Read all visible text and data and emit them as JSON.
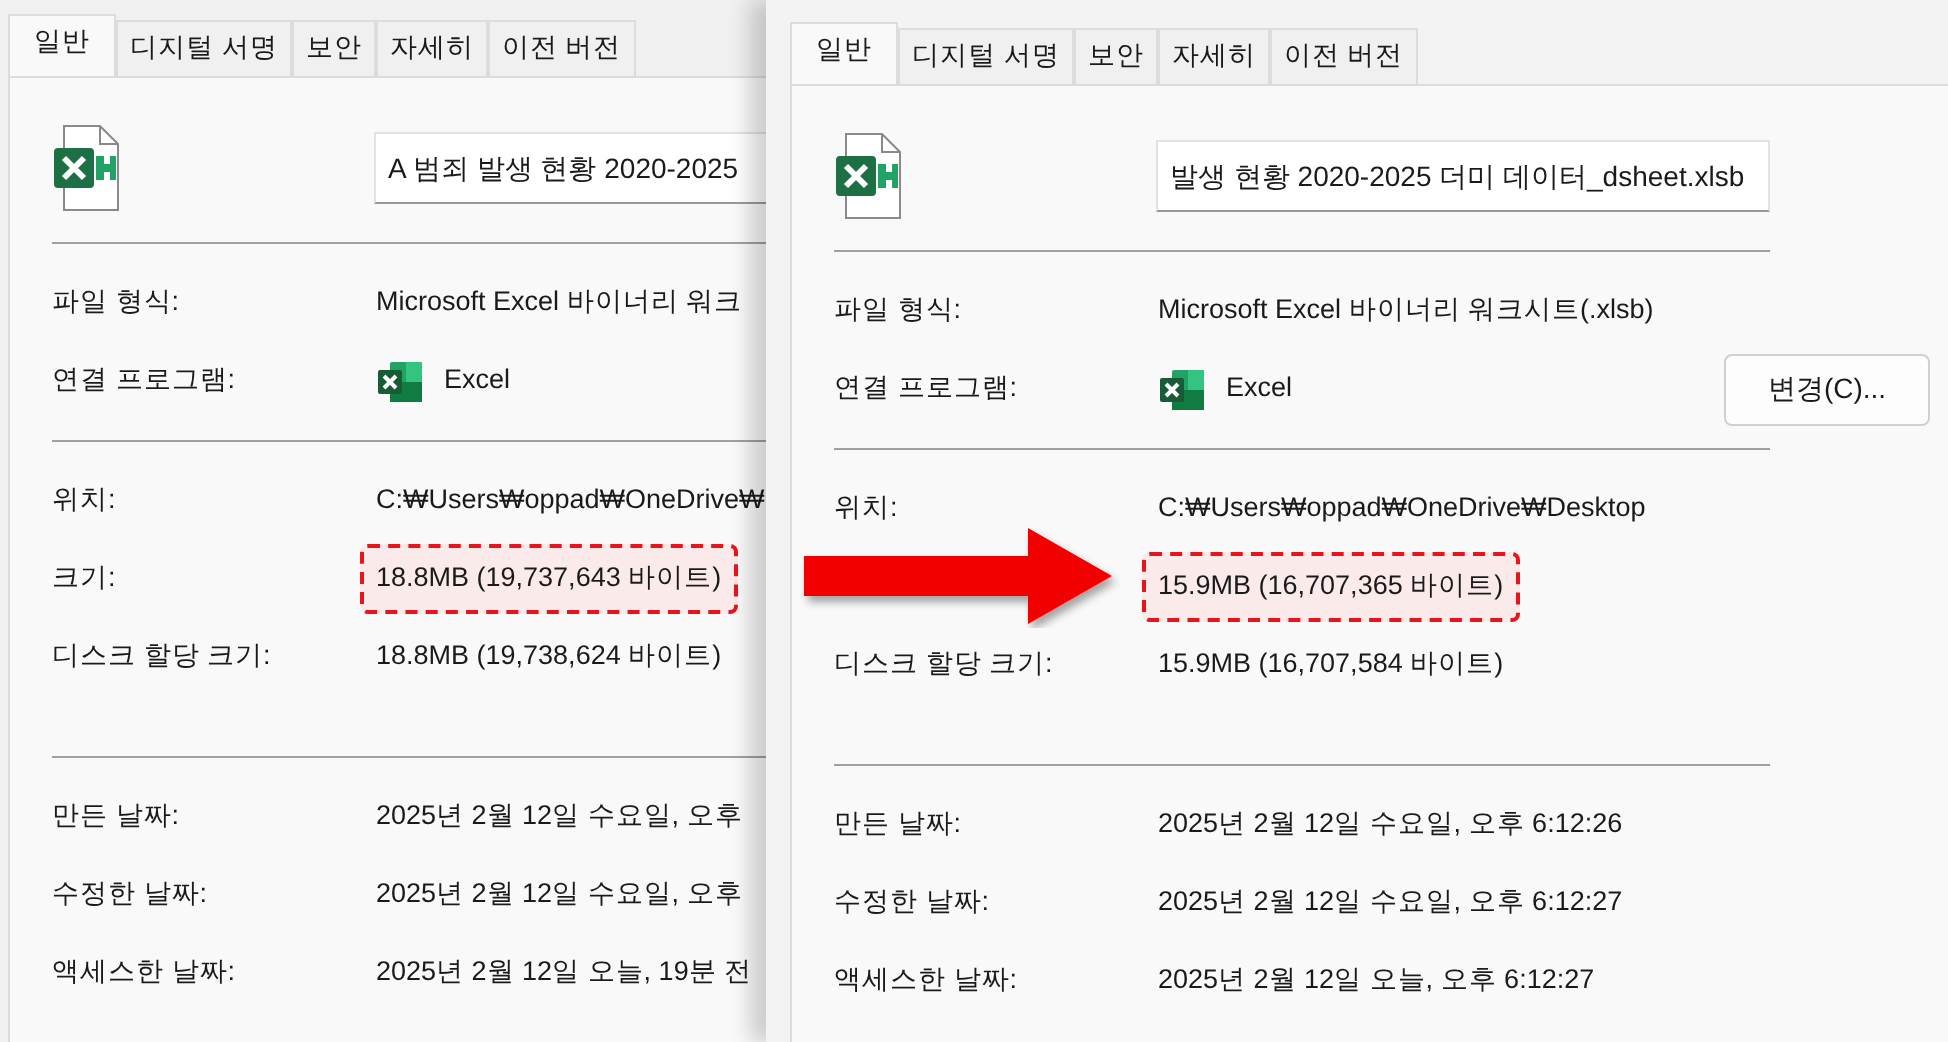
{
  "dialogs": [
    {
      "tabs": [
        {
          "label": "일반",
          "selected": true
        },
        {
          "label": "디지털 서명",
          "selected": false
        },
        {
          "label": "보안",
          "selected": false
        },
        {
          "label": "자세히",
          "selected": false
        },
        {
          "label": "이전 버전",
          "selected": false
        }
      ],
      "file_name": "A 범죄 발생 현황 2020-2025",
      "sections": [
        [
          {
            "kind": "text",
            "label": "파일 형식:",
            "value": "Microsoft Excel 바이너리 워크",
            "highlighted": false
          },
          {
            "kind": "program",
            "label": "연결 프로그램:",
            "value": "Excel",
            "highlighted": false
          }
        ],
        [
          {
            "kind": "text",
            "label": "위치:",
            "value": "C:₩Users₩oppad₩OneDrive₩",
            "highlighted": false
          },
          {
            "kind": "text",
            "label": "크기:",
            "value": "18.8MB (19,737,643 바이트)",
            "highlighted": true
          },
          {
            "kind": "text",
            "label": "디스크 할당 크기:",
            "value": "18.8MB (19,738,624 바이트)",
            "highlighted": false
          }
        ],
        [
          {
            "kind": "text",
            "label": "만든 날짜:",
            "value": "2025년 2월 12일 수요일, 오후",
            "highlighted": false
          },
          {
            "kind": "text",
            "label": "수정한 날짜:",
            "value": "2025년 2월 12일 수요일, 오후",
            "highlighted": false
          },
          {
            "kind": "text",
            "label": "액세스한 날짜:",
            "value": "2025년 2월 12일 오늘, 19분 전",
            "highlighted": false
          }
        ]
      ]
    },
    {
      "tabs": [
        {
          "label": "일반",
          "selected": true
        },
        {
          "label": "디지털 서명",
          "selected": false
        },
        {
          "label": "보안",
          "selected": false
        },
        {
          "label": "자세히",
          "selected": false
        },
        {
          "label": "이전 버전",
          "selected": false
        }
      ],
      "file_name": "발생 현황 2020-2025 더미 데이터_dsheet.xlsb",
      "change_button": "변경(C)...",
      "sections": [
        [
          {
            "kind": "text",
            "label": "파일 형식:",
            "value": "Microsoft Excel 바이너리 워크시트(.xlsb)",
            "highlighted": false
          },
          {
            "kind": "program",
            "label": "연결 프로그램:",
            "value": "Excel",
            "highlighted": false
          }
        ],
        [
          {
            "kind": "text",
            "label": "위치:",
            "value": "C:₩Users₩oppad₩OneDrive₩Desktop",
            "highlighted": false
          },
          {
            "kind": "text",
            "value": "15.9MB (16,707,365 바이트)",
            "highlighted": true
          },
          {
            "kind": "text",
            "label": "디스크 할당 크기:",
            "value": "15.9MB (16,707,584 바이트)",
            "highlighted": false
          }
        ],
        [
          {
            "kind": "text",
            "label": "만든 날짜:",
            "value": "2025년 2월 12일 수요일, 오후 6:12:26",
            "highlighted": false
          },
          {
            "kind": "text",
            "label": "수정한 날짜:",
            "value": "2025년 2월 12일 수요일, 오후 6:12:27",
            "highlighted": false
          },
          {
            "kind": "text",
            "label": "액세스한 날짜:",
            "value": "2025년 2월 12일 오늘, 오후 6:12:27",
            "highlighted": false
          }
        ]
      ]
    }
  ]
}
